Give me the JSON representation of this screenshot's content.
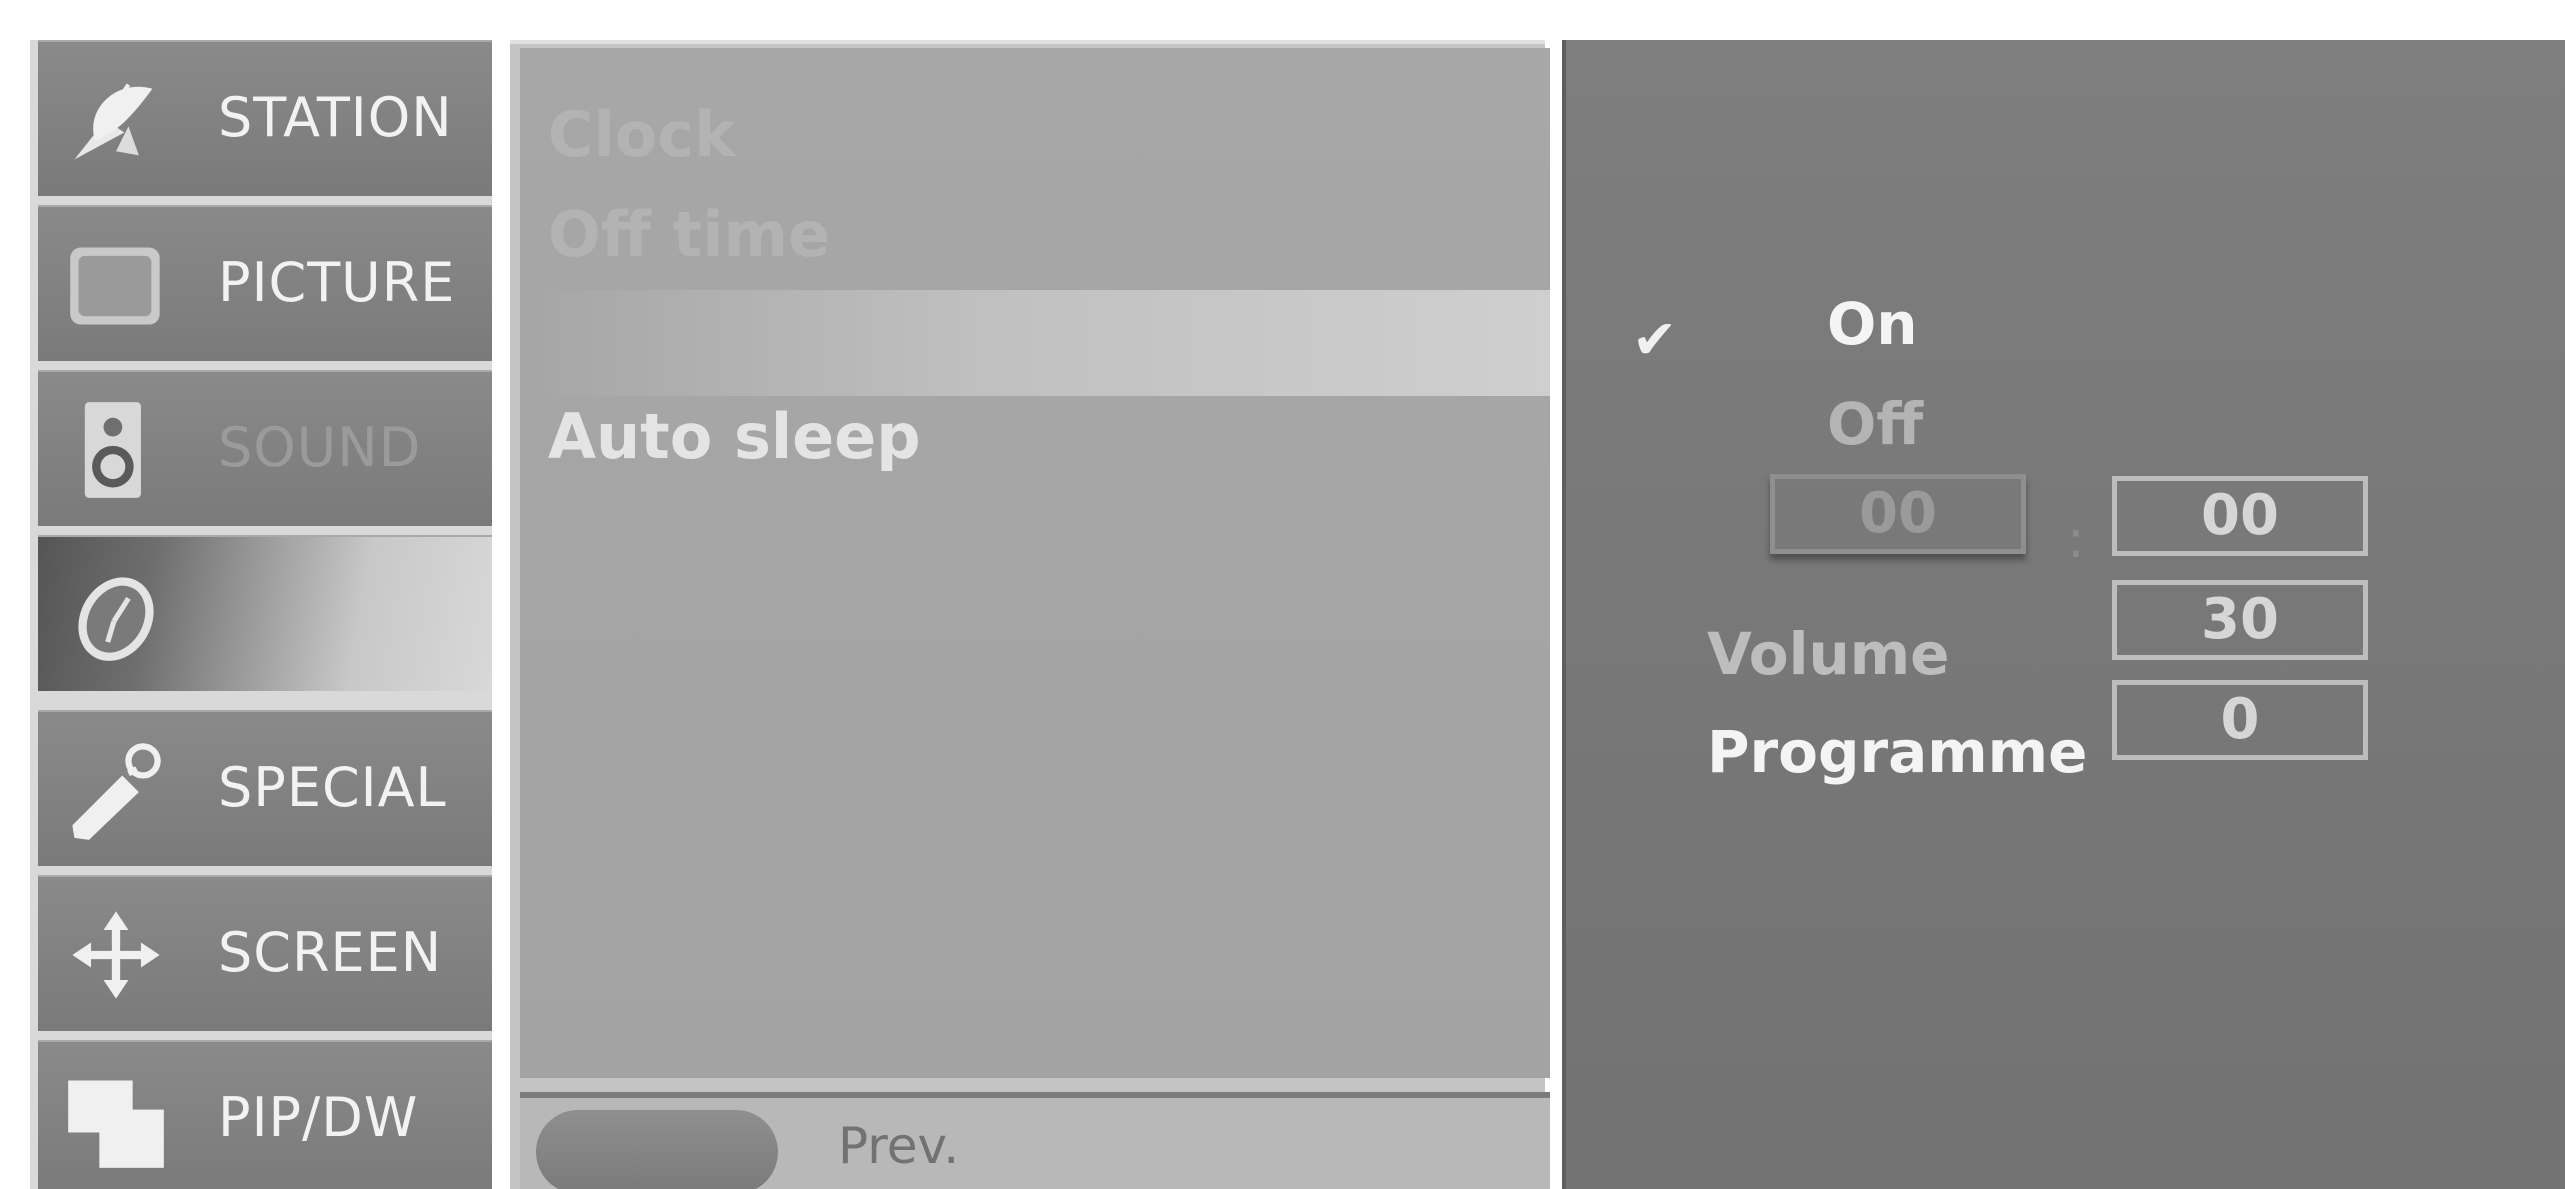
{
  "categories": [
    {
      "label": "STATION",
      "icon": "satellite-dish-icon",
      "state": "normal"
    },
    {
      "label": "PICTURE",
      "icon": "tv-screen-icon",
      "state": "normal"
    },
    {
      "label": "SOUND",
      "icon": "speaker-icon",
      "state": "faded"
    },
    {
      "label": "",
      "icon": "clock-icon",
      "state": "active"
    },
    {
      "label": "SPECIAL",
      "icon": "tag-icon",
      "state": "normal"
    },
    {
      "label": "SCREEN",
      "icon": "move-arrows-icon",
      "state": "normal"
    },
    {
      "label": "PIP/DW",
      "icon": "pip-windows-icon",
      "state": "normal"
    }
  ],
  "submenu": {
    "items": [
      {
        "label": "Clock",
        "state": "ghost"
      },
      {
        "label": "Off time",
        "state": "ghost"
      },
      {
        "label": "",
        "state": "selected"
      },
      {
        "label": "Auto sleep",
        "state": "normal"
      }
    ],
    "prev_label": "Prev."
  },
  "detail": {
    "options": [
      {
        "label": "On",
        "checked": true
      },
      {
        "label": "Off",
        "checked": false
      }
    ],
    "check_symbol": "✔",
    "time": {
      "hour": "00",
      "separator": ":",
      "minute": "00"
    },
    "volume": {
      "label": "Volume",
      "value": "30"
    },
    "programme": {
      "label": "Programme",
      "value": "0"
    }
  },
  "colors": {
    "category_bg": "#7f7f7f",
    "submenu_bg": "#a5a5a5",
    "detail_bg": "#787878",
    "text_bright": "#f4f4f4",
    "text_dim": "#b4b4b4"
  }
}
